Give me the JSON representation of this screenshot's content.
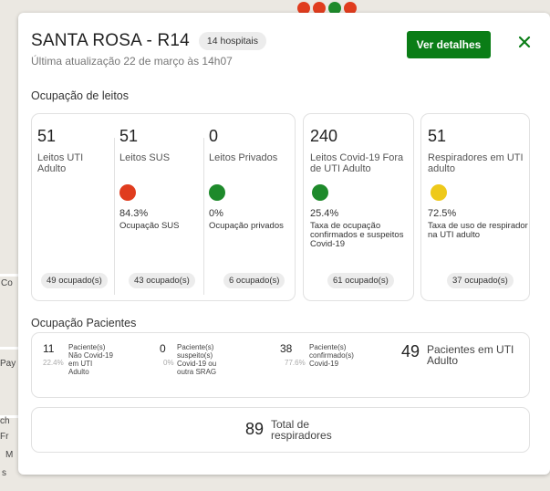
{
  "map": {
    "dot_colors": [
      "#e03c1e",
      "#e03c1e",
      "#1e8a2b",
      "#e03c1e"
    ],
    "labels": [
      "Co",
      "Pay",
      "ch",
      "Fr",
      "M",
      "s"
    ]
  },
  "header": {
    "title": "SANTA ROSA - R14",
    "hospitals_badge": "14 hospitais",
    "updated": "Última atualização 22 de março às 14h07",
    "details_button": "Ver detalhes",
    "close_icon": "close-icon"
  },
  "beds": {
    "section_title": "Ocupação de leitos",
    "uti_adulto": {
      "value": "51",
      "label": "Leitos UTI Adulto",
      "occupied": "49 ocupado(s)"
    },
    "sus": {
      "value": "51",
      "label": "Leitos SUS",
      "pct": "84.3%",
      "pct_label": "Ocupação SUS",
      "occupied": "43 ocupado(s)",
      "status_color": "#e03c1e"
    },
    "privados": {
      "value": "0",
      "label": "Leitos Privados",
      "pct": "0%",
      "pct_label": "Ocupação privados",
      "occupied": "6 ocupado(s)",
      "status_color": "#1e8a2b"
    },
    "covid_fora": {
      "value": "240",
      "label": "Leitos Covid-19 Fora de UTI Adulto",
      "pct": "25.4%",
      "pct_label": "Taxa de ocupação confirmados e suspeitos Covid-19",
      "occupied": "61 ocupado(s)",
      "status_color": "#1e8a2b"
    },
    "respiradores": {
      "value": "51",
      "label": "Respiradores em UTI adulto",
      "pct": "72.5%",
      "pct_label": "Taxa de uso de respirador na UTI adulto",
      "occupied": "37 ocupado(s)",
      "status_color": "#eec91a"
    }
  },
  "patients": {
    "section_title": "Ocupação Pacientes",
    "nao_covid": {
      "value": "11",
      "pct": "22.4%",
      "label": "Paciente(s) Não Covid-19 em UTI Adulto"
    },
    "suspeitos": {
      "value": "0",
      "pct": "0%",
      "label": "Paciente(s) suspeito(s) Covid-19 ou outra SRAG"
    },
    "confirmados": {
      "value": "38",
      "pct": "77.6%",
      "label": "Paciente(s) confirmado(s) Covid-19"
    },
    "total_uti": {
      "value": "49",
      "label": "Pacientes em UTI Adulto"
    }
  },
  "respirators": {
    "value": "89",
    "label": "Total de respiradores"
  }
}
